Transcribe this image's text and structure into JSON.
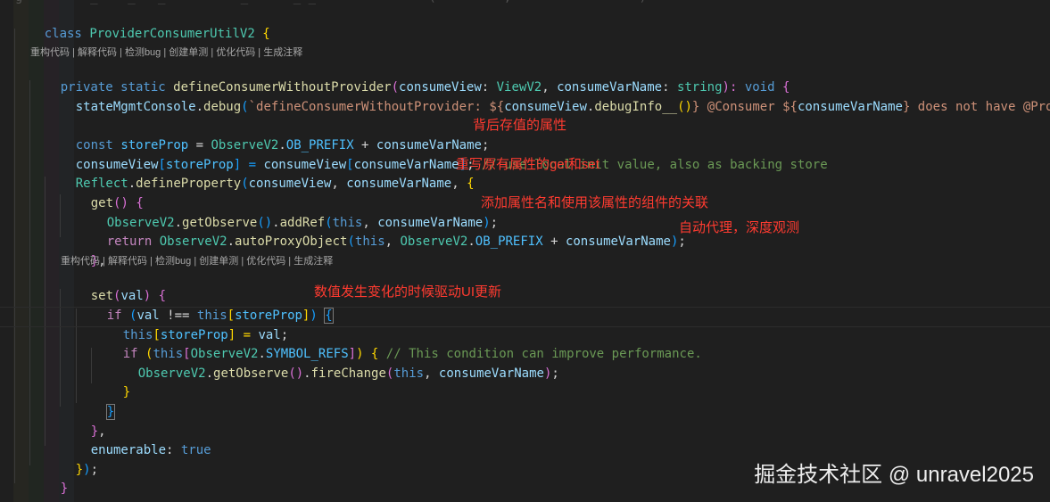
{
  "editor": {
    "top_fragment": "  g         _    _   _          _      _ _               (         ,                 )",
    "codelens_1": "重构代码 | 解释代码 | 检测bug | 创建单测 | 优化代码 | 生成注释",
    "codelens_2": "重构代码 | 解释代码 | 检测bug | 创建单测 | 优化代码 | 生成注释"
  },
  "annotations": {
    "a1": "背后存值的属性",
    "a2": "重写原有属性的get和set",
    "a3": "添加属性名和使用该属性的组件的关联",
    "a4": "自动代理，深度观测",
    "a5": "数值发生变化的时候驱动UI更新"
  },
  "code": {
    "l1": [
      "class",
      " ",
      "ProviderConsumerUtilV2",
      " ",
      "{"
    ],
    "l2": [
      "private static",
      " ",
      "defineConsumerWithoutProvider",
      "(",
      "consumeView",
      ": ",
      "ViewV2",
      ", ",
      "consumeVarName",
      ": ",
      "string",
      "): ",
      "void",
      " ",
      "{"
    ],
    "l3": [
      "stateMgmtConsole",
      ".",
      "debug",
      "(",
      "`defineConsumerWithoutProvider: ${",
      "consumeView",
      ".",
      "debugInfo__",
      "()",
      "} @Consumer ${",
      "consumeVarName",
      "} does not have @Pro"
    ],
    "l4": [
      "const",
      " ",
      "storeProp",
      " = ",
      "ObserveV2",
      ".",
      "OB_PREFIX",
      " + ",
      "consumeVarName",
      ";"
    ],
    "l5": [
      "consumeView",
      "[",
      "storeProp",
      "] = ",
      "consumeView",
      "[",
      "consumeVarName",
      "]",
      "; ",
      "// use local init value, also as backing store"
    ],
    "l6": [
      "Reflect",
      ".",
      "defineProperty",
      "(",
      "consumeView",
      ", ",
      "consumeVarName",
      ", ",
      "{"
    ],
    "l7": [
      "get",
      "() ",
      "{"
    ],
    "l8": [
      "ObserveV2",
      ".",
      "getObserve",
      "()",
      ".",
      "addRef",
      "(",
      "this",
      ", ",
      "consumeVarName",
      ")",
      ";"
    ],
    "l9": [
      "return",
      " ",
      "ObserveV2",
      ".",
      "autoProxyObject",
      "(",
      "this",
      ", ",
      "ObserveV2",
      ".",
      "OB_PREFIX",
      " + ",
      "consumeVarName",
      ")",
      ";"
    ],
    "l10": [
      "}",
      ","
    ],
    "l11": [
      "set",
      "(",
      "val",
      ") ",
      "{"
    ],
    "l12": [
      "if",
      " ",
      "(",
      "val",
      " !== ",
      "this",
      "[",
      "storeProp",
      "]",
      ") ",
      "{"
    ],
    "l13": [
      "this",
      "[",
      "storeProp",
      "] = ",
      "val",
      ";"
    ],
    "l14": [
      "if",
      " ",
      "(",
      "this",
      "[",
      "ObserveV2",
      ".",
      "SYMBOL_REFS",
      "]",
      ") ",
      "{",
      " ",
      "// This condition can improve performance."
    ],
    "l15": [
      "ObserveV2",
      ".",
      "getObserve",
      "()",
      ".",
      "fireChange",
      "(",
      "this",
      ", ",
      "consumeVarName",
      ")",
      ";"
    ],
    "l16": [
      "}"
    ],
    "l17": [
      "}"
    ],
    "l18": [
      "}",
      ","
    ],
    "l19": [
      "enumerable",
      ": ",
      "true"
    ],
    "l20": [
      "}",
      ")",
      ";"
    ],
    "l21": [
      "}"
    ],
    "l22": [
      "}"
    ]
  },
  "watermark": "掘金技术社区 @ unravel2025"
}
